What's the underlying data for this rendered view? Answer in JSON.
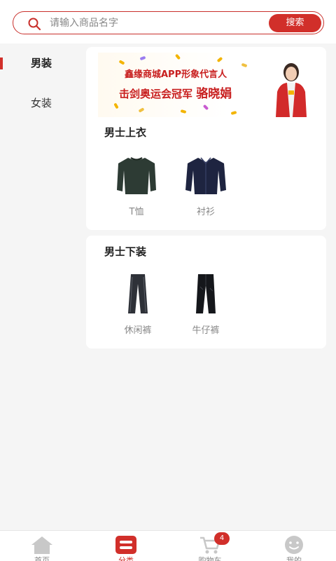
{
  "search": {
    "placeholder": "请输入商品名字",
    "button_label": "搜索"
  },
  "sidebar": {
    "items": [
      {
        "label": "男装",
        "active": true
      },
      {
        "label": "女装",
        "active": false
      }
    ]
  },
  "banner": {
    "line1": "鑫缘商城APP形象代言人",
    "line2_prefix": "击剑奥运会冠军",
    "line2_name": "骆晓娟"
  },
  "sections": [
    {
      "title": "男士上衣",
      "products": [
        {
          "label": "T恤",
          "icon": "sweater-icon"
        },
        {
          "label": "衬衫",
          "icon": "shirt-icon"
        }
      ]
    },
    {
      "title": "男士下装",
      "products": [
        {
          "label": "休闲裤",
          "icon": "casual-pants-icon"
        },
        {
          "label": "牛仔裤",
          "icon": "jeans-icon"
        }
      ]
    }
  ],
  "tabbar": {
    "tabs": [
      {
        "label": "首页",
        "icon": "home-icon"
      },
      {
        "label": "分类",
        "icon": "category-icon",
        "active": true
      },
      {
        "label": "购物车",
        "icon": "cart-icon",
        "badge": "4"
      },
      {
        "label": "我的",
        "icon": "smiley-icon"
      }
    ]
  },
  "colors": {
    "accent": "#d12f2a",
    "background": "#f5f5f5"
  }
}
